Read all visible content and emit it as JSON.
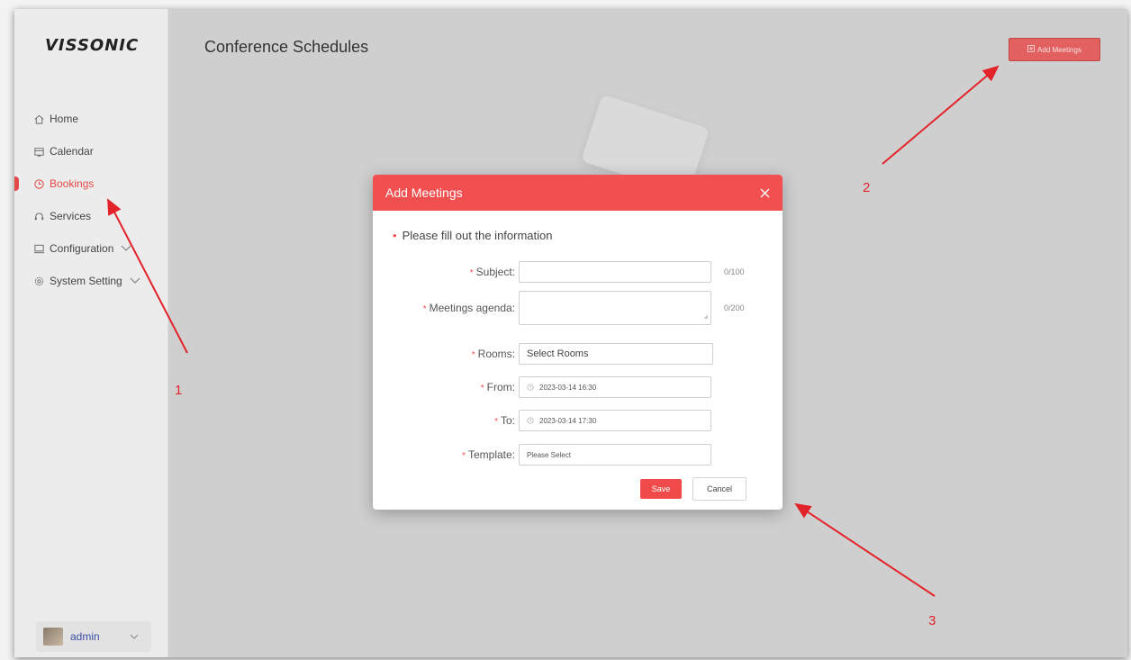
{
  "brand": {
    "logo": "VISSONIC"
  },
  "sidebar": {
    "items": [
      {
        "label": "Home",
        "icon": "home-icon"
      },
      {
        "label": "Calendar",
        "icon": "calendar-icon"
      },
      {
        "label": "Bookings",
        "icon": "clock-icon",
        "active": true
      },
      {
        "label": "Services",
        "icon": "headset-icon"
      },
      {
        "label": "Configuration",
        "icon": "monitor-icon",
        "has_submenu": true
      },
      {
        "label": "System Setting",
        "icon": "gear-icon",
        "has_submenu": true
      }
    ],
    "user": {
      "name": "admin"
    }
  },
  "header": {
    "title": "Conference Schedules",
    "add_button": "Add Meetings"
  },
  "modal": {
    "title": "Add Meetings",
    "info": "Please fill out the information",
    "fields": {
      "subject": {
        "label": "Subject:",
        "value": "",
        "counter": "0/100"
      },
      "agenda": {
        "label": "Meetings agenda:",
        "value": "",
        "counter": "0/200"
      },
      "rooms": {
        "label": "Rooms:",
        "placeholder": "Select Rooms"
      },
      "from": {
        "label": "From:",
        "value": "2023-03-14 16:30"
      },
      "to": {
        "label": "To:",
        "value": "2023-03-14 17:30"
      },
      "template": {
        "label": "Template:",
        "placeholder": "Please Select"
      }
    },
    "save": "Save",
    "cancel": "Cancel"
  },
  "annotations": {
    "labels": [
      "1",
      "2",
      "3"
    ],
    "color": "#e3232a"
  },
  "colors": {
    "accent": "#f25050",
    "active_nav": "#e54848"
  }
}
